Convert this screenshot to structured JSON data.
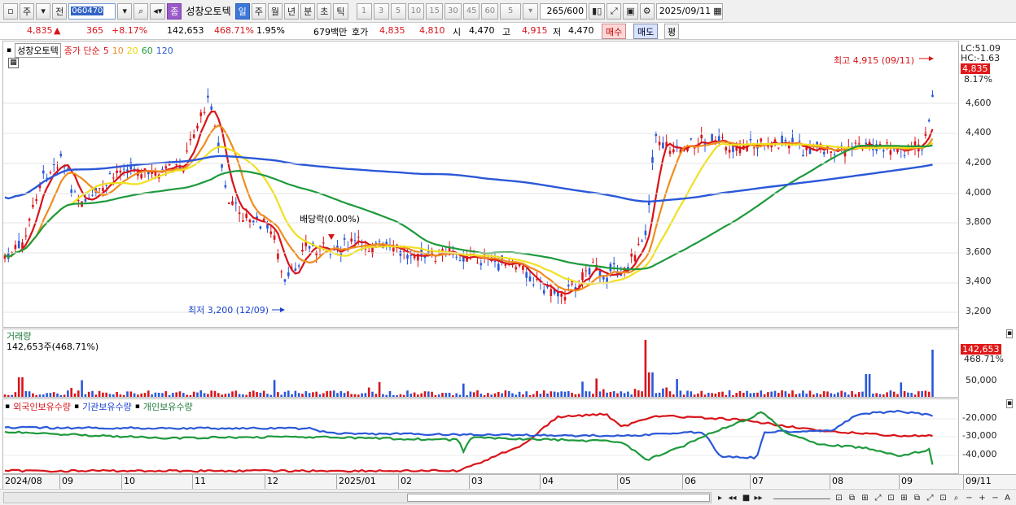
{
  "toolbar": {
    "market_buttons": [
      "주",
      "전"
    ],
    "code": "060470",
    "name_badge": "종",
    "stock_name": "성창오토텍",
    "period_buttons": [
      "일",
      "주",
      "월",
      "년",
      "분",
      "초",
      "틱"
    ],
    "minute_buttons": [
      "1",
      "3",
      "5",
      "10",
      "15",
      "30",
      "45",
      "60"
    ],
    "minute_select": "5",
    "count": "265",
    "count_total": "/600",
    "date": "2025/09/11"
  },
  "info": {
    "price": "4,835",
    "change": "365",
    "change_pct": "+8.17%",
    "volume": "142,653",
    "volume_ratio": "468.71%",
    "turnover": "1.95%",
    "amount": "679백만",
    "quote_label": "호가",
    "ask": "4,835",
    "bid": "4,810",
    "open_label": "시",
    "open": "4,470",
    "high_label": "고",
    "high": "4,915",
    "low_label": "저",
    "low": "4,470",
    "buy_label": "매수",
    "sell_label": "매도",
    "eval_label": "평"
  },
  "price_chart": {
    "name_chip": "성창오토텍",
    "ma_title": "종가 단순",
    "ma_periods": [
      "5",
      "10",
      "20",
      "60",
      "120"
    ],
    "ma_colors": [
      "#d8141a",
      "#f08c1e",
      "#f0e020",
      "#1e9a3c",
      "#2a58d8"
    ],
    "y_ticks": [
      "4,600",
      "4,400",
      "4,200",
      "4,000",
      "3,800",
      "3,600",
      "3,400",
      "3,200"
    ],
    "high_note": "최고 4,915 (09/11)",
    "low_note": "최저 3,200 (12/09)",
    "dividend_note": "배당락(0.00%)",
    "lc": "LC:51.09",
    "hc": "HC:-1.63",
    "last_price": "4,835",
    "last_pct": "8.17%"
  },
  "volume_chart": {
    "title": "거래량",
    "value": "142,653주(468.71%)",
    "y_ticks": [
      "50,000"
    ],
    "last_value": "142,653",
    "last_pct": "468.71%"
  },
  "holdings_chart": {
    "series": [
      "외국인보유수량",
      "기관보유수량",
      "개인보유수량"
    ],
    "colors": [
      "#d8141a",
      "#2a58d8",
      "#1e9a3c"
    ],
    "y_ticks": [
      "-20,000",
      "-30,000",
      "-40,000"
    ]
  },
  "time_axis": [
    "2024/08",
    "09",
    "10",
    "11",
    "12",
    "2025/01",
    "02",
    "03",
    "04",
    "05",
    "06",
    "07",
    "08",
    "09"
  ],
  "time_axis_right": "09/11"
}
